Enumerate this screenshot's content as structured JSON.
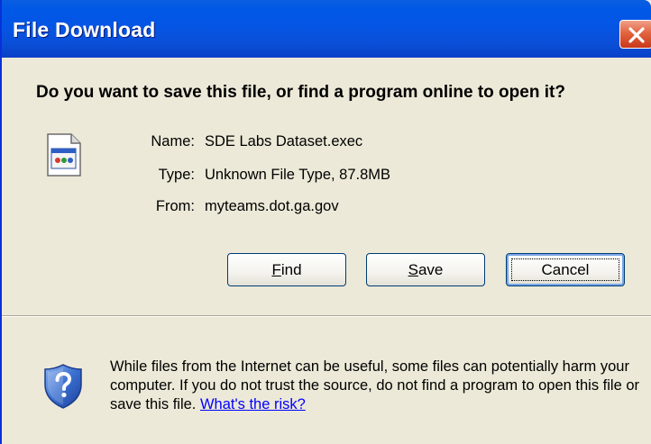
{
  "window": {
    "title": "File Download"
  },
  "dialog": {
    "question": "Do you want to save this file, or find a program online to open it?",
    "file": {
      "name_label": "Name:",
      "name_value": "SDE Labs Dataset.exec",
      "type_label": "Type:",
      "type_value": "Unknown File Type, 87.8MB",
      "from_label": "From:",
      "from_value": "myteams.dot.ga.gov"
    },
    "buttons": {
      "find_mnemonic": "F",
      "find_rest": "ind",
      "save_mnemonic": "S",
      "save_rest": "ave",
      "cancel": "Cancel"
    },
    "warning": {
      "text": "While files from the Internet can be useful, some files can potentially harm your computer. If you do not trust the source, do not find a program to open this file or save this file.",
      "link": "What's the risk?"
    }
  },
  "icons": {
    "close": "close-icon",
    "file": "file-icon",
    "shield": "shield-question-icon"
  },
  "colors": {
    "titlebar": "#0058e6",
    "dialog_bg": "#ece9d8",
    "close": "#e2643f",
    "link": "#0000ff"
  }
}
